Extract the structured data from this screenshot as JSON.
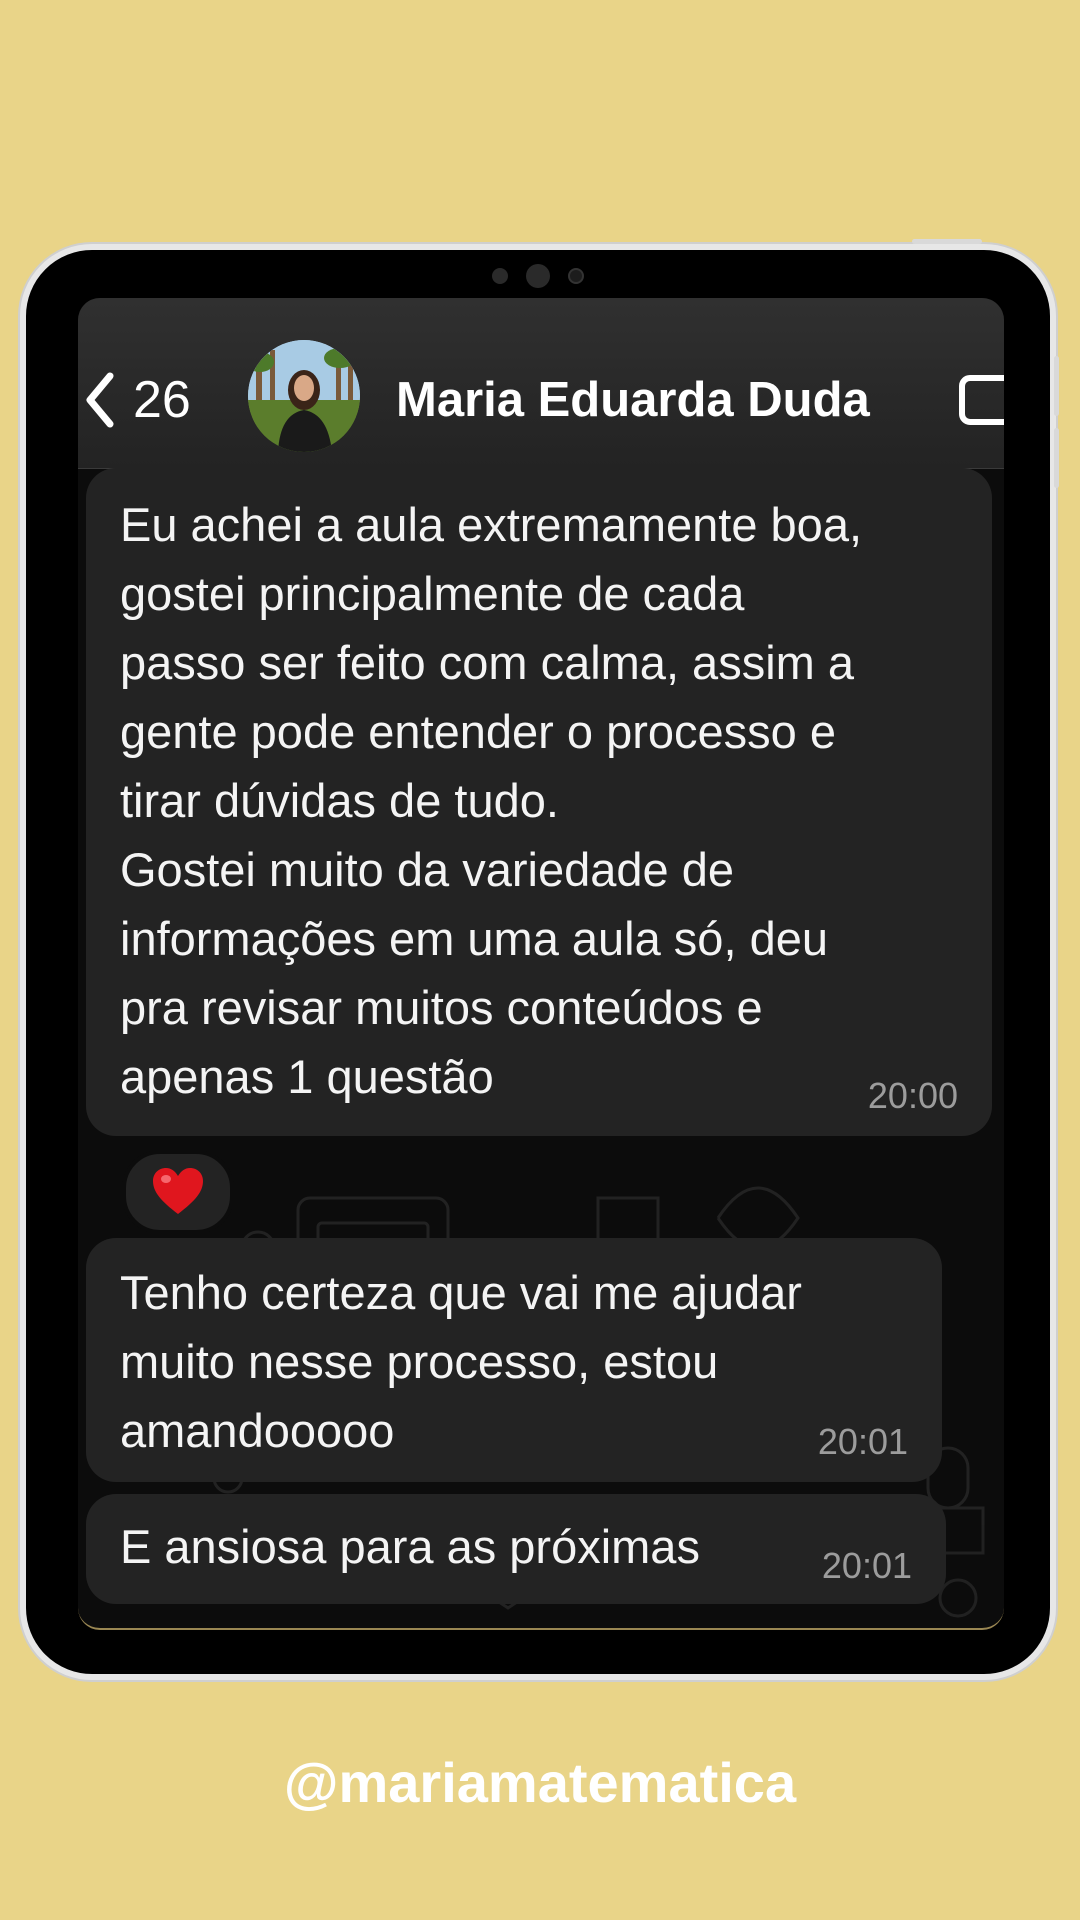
{
  "header": {
    "back_count": "26",
    "contact_name": "Maria Eduarda Duda"
  },
  "messages": [
    {
      "text": "Eu achei a aula extremamente boa,\ngostei principalmente de cada\npasso ser feito com calma, assim a\ngente pode entender o processo e\ntirar dúvidas de tudo.\nGostei muito da variedade de\ninformações em uma aula só, deu\npra revisar muitos conteúdos e\napenas 1 questão",
      "time": "20:00",
      "reaction": "❤️"
    },
    {
      "text": "Tenho certeza que vai me ajudar\nmuito nesse processo, estou\namandooooo",
      "time": "20:01"
    },
    {
      "text": "E ansiosa para as próximas",
      "time": "20:01"
    }
  ],
  "footer": {
    "handle": "@mariamatematica"
  },
  "colors": {
    "background": "#e9d488",
    "bubble": "#232323",
    "timestamp": "#9c9c9c"
  },
  "icons": [
    "back-chevron-icon",
    "video-call-icon",
    "heart-reaction-icon"
  ]
}
